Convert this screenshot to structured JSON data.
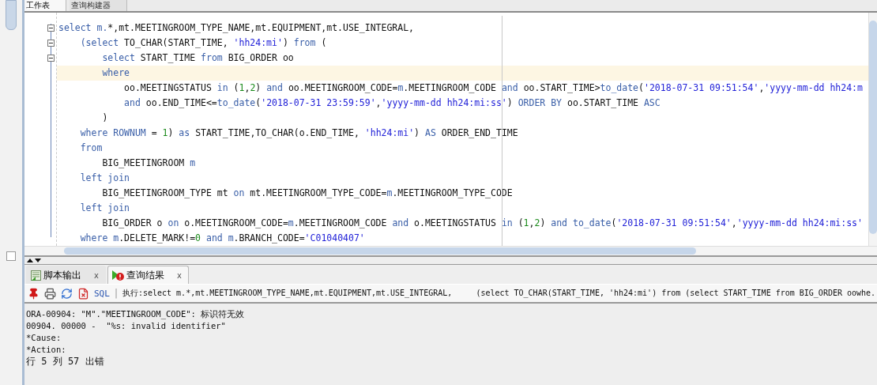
{
  "top_tabs": [
    {
      "label": "工作表",
      "selected": true
    },
    {
      "label": "查询构建器",
      "selected": false
    }
  ],
  "editor": {
    "lines": [
      {
        "folding": true,
        "highlighted": false,
        "tokens": [
          {
            "kind": "keyword",
            "text": "select m."
          },
          {
            "kind": "plain",
            "text": "*,mt.MEETINGROOM_TYPE_NAME,mt.EQUIPMENT,mt.USE_INTEGRAL,"
          }
        ]
      },
      {
        "folding": true,
        "highlighted": false,
        "tokens": [
          {
            "kind": "keyword",
            "text": "    (select "
          },
          {
            "kind": "plain",
            "text": "TO_CHAR(START_TIME, "
          },
          {
            "kind": "string",
            "text": "'hh24:mi'"
          },
          {
            "kind": "plain",
            "text": ") "
          },
          {
            "kind": "keyword",
            "text": "from "
          },
          {
            "kind": "plain",
            "text": "("
          }
        ]
      },
      {
        "folding": true,
        "highlighted": false,
        "tokens": [
          {
            "kind": "keyword",
            "text": "        select "
          },
          {
            "kind": "plain",
            "text": "START_TIME "
          },
          {
            "kind": "keyword",
            "text": "from "
          },
          {
            "kind": "plain",
            "text": "BIG_ORDER oo"
          }
        ]
      },
      {
        "folding": false,
        "highlighted": true,
        "tokens": [
          {
            "kind": "keyword",
            "text": "        where"
          }
        ]
      },
      {
        "folding": false,
        "highlighted": false,
        "tokens": [
          {
            "kind": "plain",
            "text": "            oo.MEETINGSTATUS "
          },
          {
            "kind": "keyword",
            "text": "in "
          },
          {
            "kind": "plain",
            "text": "("
          },
          {
            "kind": "number",
            "text": "1"
          },
          {
            "kind": "plain",
            "text": ","
          },
          {
            "kind": "number",
            "text": "2"
          },
          {
            "kind": "plain",
            "text": ") "
          },
          {
            "kind": "keyword",
            "text": "and "
          },
          {
            "kind": "plain",
            "text": "oo.MEETINGROOM_CODE="
          },
          {
            "kind": "keyword",
            "text": "m"
          },
          {
            "kind": "plain",
            "text": ".MEETINGROOM_CODE "
          },
          {
            "kind": "keyword",
            "text": "and "
          },
          {
            "kind": "plain",
            "text": "oo.START_TIME>"
          },
          {
            "kind": "keyword",
            "text": "to_date"
          },
          {
            "kind": "plain",
            "text": "("
          },
          {
            "kind": "string",
            "text": "'2018-07-31 09:51:54'"
          },
          {
            "kind": "plain",
            "text": ","
          },
          {
            "kind": "string",
            "text": "'yyyy-mm-dd hh24:m"
          }
        ]
      },
      {
        "folding": false,
        "highlighted": false,
        "tokens": [
          {
            "kind": "keyword",
            "text": "            and "
          },
          {
            "kind": "plain",
            "text": "oo.END_TIME<="
          },
          {
            "kind": "keyword",
            "text": "to_date"
          },
          {
            "kind": "plain",
            "text": "("
          },
          {
            "kind": "string",
            "text": "'2018-07-31 23:59:59'"
          },
          {
            "kind": "plain",
            "text": ","
          },
          {
            "kind": "string",
            "text": "'yyyy-mm-dd hh24:mi:ss'"
          },
          {
            "kind": "plain",
            "text": ") "
          },
          {
            "kind": "keyword",
            "text": "ORDER BY "
          },
          {
            "kind": "plain",
            "text": "oo.START_TIME "
          },
          {
            "kind": "keyword",
            "text": "ASC"
          }
        ]
      },
      {
        "folding": false,
        "highlighted": false,
        "tokens": [
          {
            "kind": "plain",
            "text": "        )"
          }
        ]
      },
      {
        "folding": false,
        "highlighted": false,
        "tokens": [
          {
            "kind": "keyword",
            "text": "    where ROWNUM "
          },
          {
            "kind": "plain",
            "text": "= "
          },
          {
            "kind": "number",
            "text": "1"
          },
          {
            "kind": "plain",
            "text": ") "
          },
          {
            "kind": "keyword",
            "text": "as "
          },
          {
            "kind": "plain",
            "text": "START_TIME,TO_CHAR(o.END_TIME, "
          },
          {
            "kind": "string",
            "text": "'hh24:mi'"
          },
          {
            "kind": "plain",
            "text": ") "
          },
          {
            "kind": "keyword",
            "text": "AS "
          },
          {
            "kind": "plain",
            "text": "ORDER_END_TIME"
          }
        ]
      },
      {
        "folding": false,
        "highlighted": false,
        "tokens": [
          {
            "kind": "keyword",
            "text": "    from"
          }
        ]
      },
      {
        "folding": false,
        "highlighted": false,
        "tokens": [
          {
            "kind": "plain",
            "text": "        BIG_MEETINGROOM "
          },
          {
            "kind": "keyword",
            "text": "m"
          }
        ]
      },
      {
        "folding": false,
        "highlighted": false,
        "tokens": [
          {
            "kind": "keyword",
            "text": "    left join"
          }
        ]
      },
      {
        "folding": false,
        "highlighted": false,
        "tokens": [
          {
            "kind": "plain",
            "text": "        BIG_MEETINGROOM_TYPE mt "
          },
          {
            "kind": "keyword",
            "text": "on "
          },
          {
            "kind": "plain",
            "text": "mt.MEETINGROOM_TYPE_CODE="
          },
          {
            "kind": "keyword",
            "text": "m"
          },
          {
            "kind": "plain",
            "text": ".MEETINGROOM_TYPE_CODE"
          }
        ]
      },
      {
        "folding": false,
        "highlighted": false,
        "tokens": [
          {
            "kind": "keyword",
            "text": "    left join"
          }
        ]
      },
      {
        "folding": false,
        "highlighted": false,
        "tokens": [
          {
            "kind": "plain",
            "text": "        BIG_ORDER o "
          },
          {
            "kind": "keyword",
            "text": "on "
          },
          {
            "kind": "plain",
            "text": "o.MEETINGROOM_CODE="
          },
          {
            "kind": "keyword",
            "text": "m"
          },
          {
            "kind": "plain",
            "text": ".MEETINGROOM_CODE "
          },
          {
            "kind": "keyword",
            "text": "and "
          },
          {
            "kind": "plain",
            "text": "o.MEETINGSTATUS "
          },
          {
            "kind": "keyword",
            "text": "in "
          },
          {
            "kind": "plain",
            "text": "("
          },
          {
            "kind": "number",
            "text": "1"
          },
          {
            "kind": "plain",
            "text": ","
          },
          {
            "kind": "number",
            "text": "2"
          },
          {
            "kind": "plain",
            "text": ") "
          },
          {
            "kind": "keyword",
            "text": "and to_date"
          },
          {
            "kind": "plain",
            "text": "("
          },
          {
            "kind": "string",
            "text": "'2018-07-31 09:51:54'"
          },
          {
            "kind": "plain",
            "text": ","
          },
          {
            "kind": "string",
            "text": "'yyyy-mm-dd hh24:mi:ss'"
          }
        ]
      },
      {
        "folding": false,
        "highlighted": false,
        "tokens": [
          {
            "kind": "keyword",
            "text": "    where m"
          },
          {
            "kind": "plain",
            "text": ".DELETE_MARK!="
          },
          {
            "kind": "number",
            "text": "0"
          },
          {
            "kind": "keyword",
            "text": " and m"
          },
          {
            "kind": "plain",
            "text": ".BRANCH_CODE="
          },
          {
            "kind": "string",
            "text": "'C01040407'"
          }
        ]
      }
    ]
  },
  "result_tabs": [
    {
      "label": "脚本输出",
      "close": "x",
      "selected": false,
      "kind": "script"
    },
    {
      "label": "查询结果",
      "close": "x",
      "selected": true,
      "kind": "error"
    }
  ],
  "toolbar": {
    "sql_label": "SQL",
    "separator": "|",
    "statement": "执行:select m.*,mt.MEETINGROOM_TYPE_NAME,mt.EQUIPMENT,mt.USE_INTEGRAL,     (select TO_CHAR(START_TIME, 'hh24:mi') from (select START_TIME from BIG_ORDER oowhe."
  },
  "output": [
    "ORA-00904: \"M\".\"MEETINGROOM_CODE\": 标识符无效",
    "00904. 00000 -  \"%s: invalid identifier\"",
    "*Cause:",
    "*Action:",
    "行 5 列 57 出错"
  ]
}
